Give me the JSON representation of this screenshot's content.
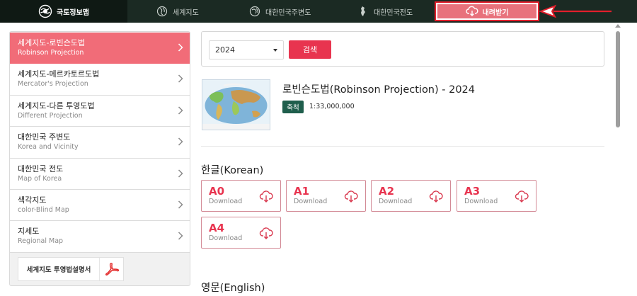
{
  "nav": {
    "logo_text": "국토정보맵",
    "items": [
      {
        "label": "세계지도",
        "icon": "globe-icon"
      },
      {
        "label": "대한민국주변도",
        "icon": "globe-icon"
      },
      {
        "label": "대한민국전도",
        "icon": "korea-map-icon"
      }
    ],
    "download": {
      "label": "내려받기",
      "icon": "cloud-download-icon"
    },
    "highlight_color": "#e21f2b"
  },
  "sidebar": {
    "items": [
      {
        "ko": "세계지도-로빈슨도법",
        "en": "Robinson Projection",
        "active": true
      },
      {
        "ko": "세계지도-메르카토르도법",
        "en": "Mercator's Projection"
      },
      {
        "ko": "세계지도-다른 투영도법",
        "en": "Different Projection"
      },
      {
        "ko": "대한민국 주변도",
        "en": "Korea and Vicinity"
      },
      {
        "ko": "대한민국 전도",
        "en": "Map of Korea"
      },
      {
        "ko": "색각지도",
        "en": "color-Blind Map"
      },
      {
        "ko": "지세도",
        "en": "Regional Map"
      }
    ],
    "manual_label": "세계지도 투영법설명서",
    "active_color": "#f16c78"
  },
  "search": {
    "year": "2024",
    "button_label": "검색",
    "accent": "#e8344f"
  },
  "map_info": {
    "title": "로빈슨도법(Robinson Projection) - 2024",
    "scale_label": "축척",
    "scale_value": "1:33,000,000"
  },
  "sections": [
    {
      "title": "한글(Korean)",
      "downloads": [
        {
          "size": "A0",
          "label": "Download"
        },
        {
          "size": "A1",
          "label": "Download"
        },
        {
          "size": "A2",
          "label": "Download"
        },
        {
          "size": "A3",
          "label": "Download"
        },
        {
          "size": "A4",
          "label": "Download"
        }
      ]
    },
    {
      "title": "영문(English)",
      "downloads": []
    }
  ]
}
